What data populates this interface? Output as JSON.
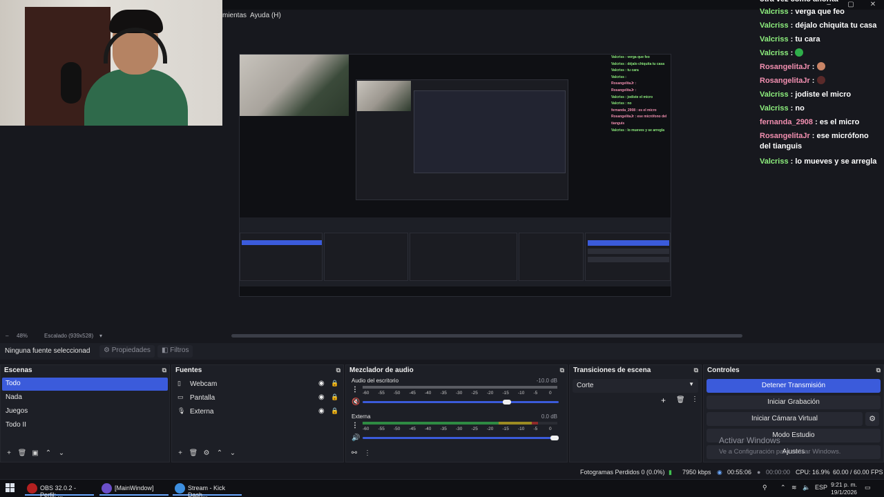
{
  "menubar": {
    "items": [
      "mientas",
      "Ayuda (H)"
    ]
  },
  "window_controls": {
    "minimize": "–",
    "maximize": "▢",
    "close": "✕"
  },
  "chat": {
    "top_fragment": "otra vez como ahorita",
    "messages": [
      {
        "user": "Valcriss",
        "text": "verga que feo",
        "style": "a"
      },
      {
        "user": "Valcriss",
        "text": "déjalo chiquita tu casa",
        "style": "a"
      },
      {
        "user": "Valcriss",
        "text": "tu cara",
        "style": "a"
      },
      {
        "user": "Valcriss",
        "text": "",
        "style": "a",
        "emote": "#2fae4a"
      },
      {
        "user": "RosangelitaJr",
        "text": "",
        "style": "b",
        "emote": "#c98466"
      },
      {
        "user": "RosangelitaJr",
        "text": "",
        "style": "b",
        "emote": "#5a2a2a"
      },
      {
        "user": "Valcriss",
        "text": "jodiste el micro",
        "style": "a"
      },
      {
        "user": "Valcriss",
        "text": "no",
        "style": "a"
      },
      {
        "user": "fernanda_2908",
        "text": "es el micro",
        "style": "b"
      },
      {
        "user": "RosangelitaJr",
        "text": "ese micrófono del tianguis",
        "style": "b"
      },
      {
        "user": "Valcriss",
        "text": "lo mueves y se arregla",
        "style": "a"
      }
    ]
  },
  "scale": {
    "zoom": "48%",
    "scaled": "Escalado (939x528)"
  },
  "props_row": {
    "no_source": "Ninguna fuente seleccionad",
    "properties": "Propiedades",
    "filters": "Filtros"
  },
  "scenes": {
    "title": "Escenas",
    "items": [
      "Todo",
      "Nada",
      "Juegos",
      "Todo II"
    ],
    "selected": "Todo",
    "toolbar": [
      "+",
      "🗑",
      "▣",
      "⌃",
      "⌄"
    ]
  },
  "sources": {
    "title": "Fuentes",
    "items": [
      {
        "label": "Webcam",
        "icon": "webcam-icon"
      },
      {
        "label": "Pantalla",
        "icon": "monitor-icon"
      },
      {
        "label": "Externa",
        "icon": "mic-icon"
      }
    ],
    "toolbar": [
      "+",
      "🗑",
      "⚙",
      "⌃",
      "⌄"
    ]
  },
  "mixer": {
    "title": "Mezclador de audio",
    "channels": [
      {
        "name": "Audio del escritorio",
        "db": "-10.0 dB",
        "level": 0.0,
        "volume": 0.75,
        "muted": true
      },
      {
        "name": "Externa",
        "db": "0.0 dB",
        "level": 0.9,
        "volume": 1.0,
        "muted": false
      }
    ],
    "ticks": [
      "-60",
      "-55",
      "-50",
      "-45",
      "-40",
      "-35",
      "-30",
      "-25",
      "-20",
      "-15",
      "-10",
      "-5",
      "0"
    ]
  },
  "transitions": {
    "title": "Transiciones de escena",
    "selected": "Corte"
  },
  "controls": {
    "title": "Controles",
    "stop_stream": "Detener Transmisión",
    "start_recording": "Iniciar Grabación",
    "virtual_camera": "Iniciar Cámara Virtual",
    "studio_mode": "Modo Estudio",
    "settings": "Ajustes",
    "watermark_title": "Activar Windows",
    "watermark_sub": "Ve a Configuración para activar Windows."
  },
  "status": {
    "dropped": "Fotogramas Perdidos 0 (0.0%)",
    "bitrate": "7950 kbps",
    "stream_time": "00:55:06",
    "rec_time": "00:00:00",
    "cpu": "CPU: 16.9%",
    "fps": "60.00 / 60.00 FPS"
  },
  "taskbar": {
    "tasks": [
      {
        "label": "OBS 32.0.2 - Perfil: ...",
        "color": "#b32020"
      },
      {
        "label": "[MainWindow]",
        "color": "#6b4fc9"
      },
      {
        "label": "Stream - Kick Dash...",
        "color": "#3d8fe0"
      }
    ],
    "lang": "ESP",
    "time": "9:21 p. m.",
    "date": "19/1/2026"
  },
  "colors": {
    "accent": "#3b5bdb",
    "meter_green": "#2e8b43",
    "bg": "#17181e"
  }
}
